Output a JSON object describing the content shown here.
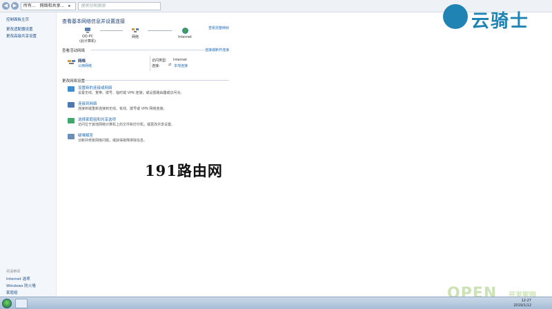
{
  "address_bar": {
    "crumbs": [
      "所有...",
      "网络和共享...",
      "▸"
    ],
    "search_placeholder": "搜索控制面板"
  },
  "sidebar": {
    "home": "控制面板主页",
    "links": [
      "更改适配器设置",
      "更改高级共享设置"
    ],
    "see_also_title": "另请参阅",
    "see_also": [
      "Internet 选项",
      "Windows 防火墙",
      "家庭组"
    ]
  },
  "main": {
    "title": "查看基本网络信息并设置连接",
    "view_full_map": "查看完整映射",
    "map": {
      "computer_name": "QQ-PC",
      "computer_sub": "(此计算机)",
      "network_label": "网络",
      "internet_label": "Internet"
    },
    "active_networks": {
      "title": "查看活动网络",
      "connect_disconnect": "连接或断开连接",
      "network_name": "网络",
      "network_type": "公用网络",
      "access_type_label": "访问类型:",
      "access_type_value": "Internet",
      "connections_label": "连接:",
      "connections_value": "本地连接"
    },
    "change_settings": {
      "title": "更改网络设置",
      "tasks": [
        {
          "title": "设置新的连接或网络",
          "desc": "设置无线、宽带、拨号、临时或 VPN 连接；或设置路由器或访问点。",
          "icon": "new-connection-icon",
          "color": "#3d8fd1"
        },
        {
          "title": "连接到网络",
          "desc": "连接到或重新连接到无线、有线、拨号或 VPN 网络连接。",
          "icon": "connect-network-icon",
          "color": "#4d78b0"
        },
        {
          "title": "选择家庭组和共享选项",
          "desc": "访问位于其他网络计算机上的文件和打印机，或更改共享设置。",
          "icon": "homegroup-icon",
          "color": "#3fa86b"
        },
        {
          "title": "疑难解答",
          "desc": "诊断并修复网络问题，或获得故障排除信息。",
          "icon": "troubleshoot-icon",
          "color": "#6a8fb8"
        }
      ]
    }
  },
  "watermarks": {
    "brand": "云骑士",
    "center": "191路由网",
    "open": "OPEN",
    "open_sub": "开发家园"
  },
  "taskbar": {
    "time": "12:27",
    "date": "2019/1/12"
  }
}
